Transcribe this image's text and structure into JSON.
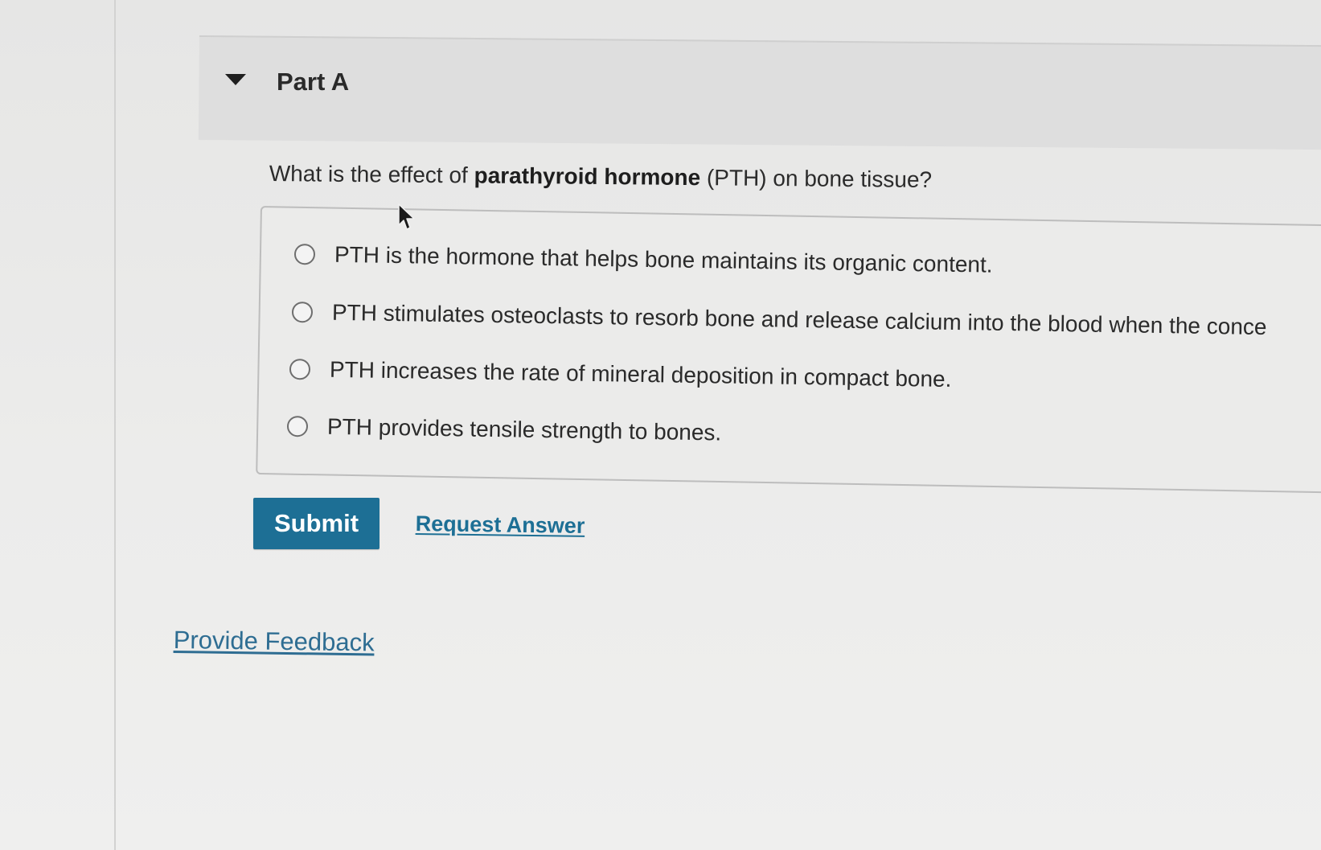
{
  "part": {
    "title": "Part A"
  },
  "question": {
    "prefix": "What is the effect of ",
    "bold": "parathyroid hormone",
    "suffix": " (PTH) on bone tissue?"
  },
  "options": [
    {
      "label": "PTH is the hormone that helps bone maintains its organic content."
    },
    {
      "label": "PTH stimulates osteoclasts to resorb bone and release calcium into the blood when the conce"
    },
    {
      "label": "PTH increases the rate of mineral deposition in compact bone."
    },
    {
      "label": "PTH provides tensile strength to bones."
    }
  ],
  "actions": {
    "submit_label": "Submit",
    "request_answer_label": "Request Answer"
  },
  "footer": {
    "feedback_label": "Provide Feedback"
  },
  "colors": {
    "accent": "#1d6f95",
    "link": "#2e6d92"
  },
  "icons": {
    "collapse": "caret-down-icon",
    "radio": "radio-unselected-icon",
    "cursor": "mouse-pointer-icon"
  }
}
